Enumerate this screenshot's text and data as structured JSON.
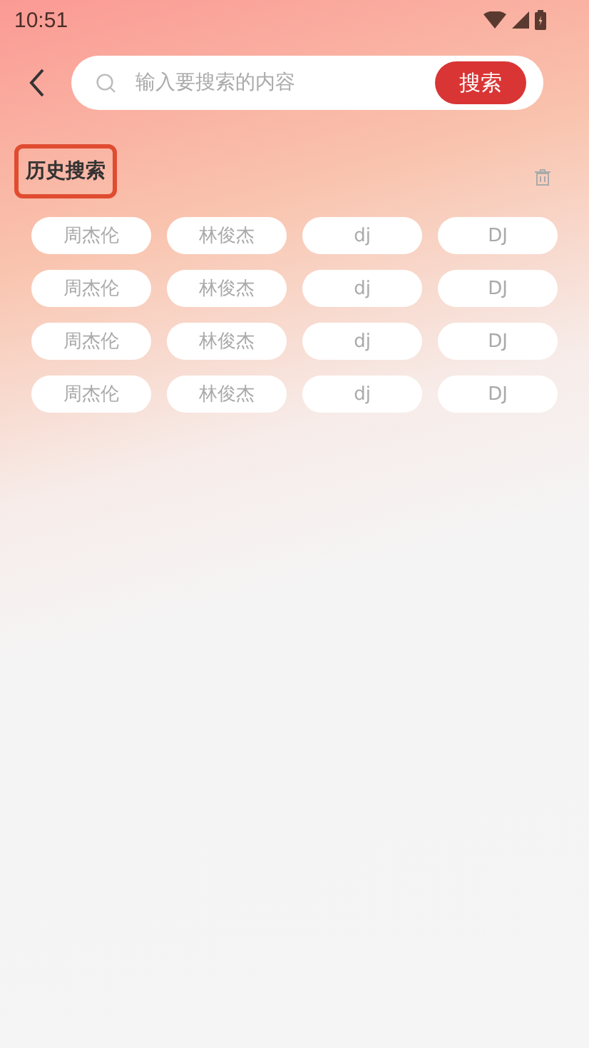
{
  "status_bar": {
    "time": "10:51"
  },
  "search": {
    "placeholder": "输入要搜索的内容",
    "button": "搜索"
  },
  "history": {
    "title": "历史搜索",
    "highlighted": true,
    "items": [
      {
        "label": "周杰伦"
      },
      {
        "label": "林俊杰"
      },
      {
        "label": "dj"
      },
      {
        "label": "DJ"
      },
      {
        "label": "周杰伦"
      },
      {
        "label": "林俊杰"
      },
      {
        "label": "dj"
      },
      {
        "label": "DJ"
      },
      {
        "label": "周杰伦"
      },
      {
        "label": "林俊杰"
      },
      {
        "label": "dj"
      },
      {
        "label": "DJ"
      },
      {
        "label": "周杰伦"
      },
      {
        "label": "林俊杰"
      },
      {
        "label": "dj"
      },
      {
        "label": "DJ"
      }
    ]
  }
}
